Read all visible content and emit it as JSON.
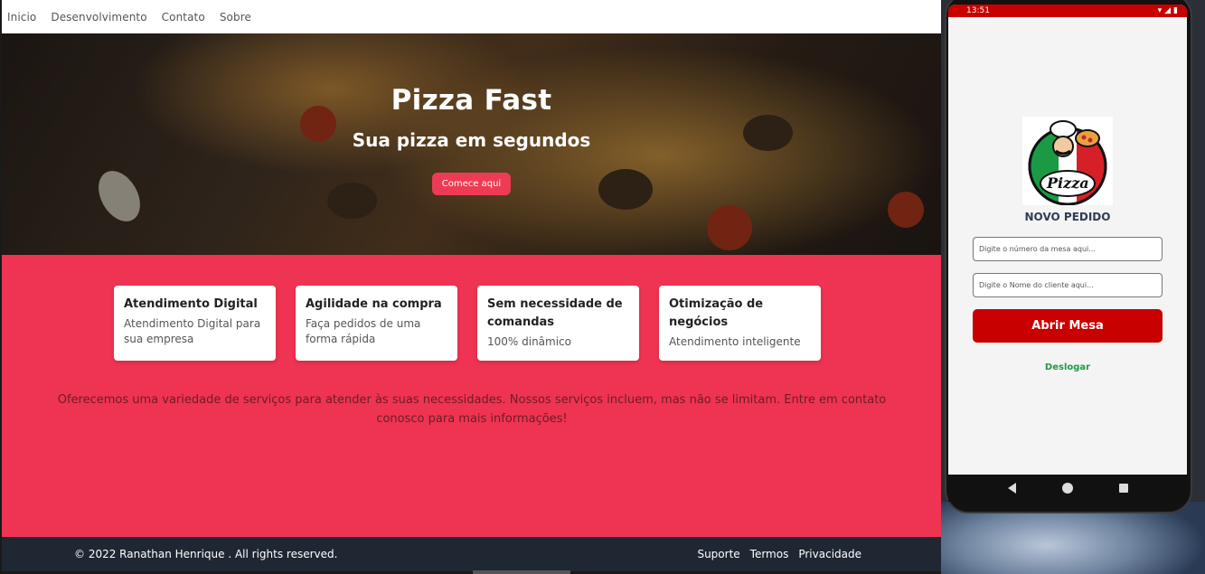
{
  "nav": {
    "items": [
      "Inicio",
      "Desenvolvimento",
      "Contato",
      "Sobre"
    ]
  },
  "hero": {
    "title": "Pizza Fast",
    "subtitle": "Sua pizza em segundos",
    "button": "Comece aqui"
  },
  "cards": [
    {
      "title": "Atendimento Digital",
      "text": "Atendimento Digital para sua empresa"
    },
    {
      "title": "Agilidade na compra",
      "text": "Faça pedidos de uma forma rápida"
    },
    {
      "title": "Sem necessidade de comandas",
      "text": "100% dinâmico"
    },
    {
      "title": "Otimização de negócios",
      "text": "Atendimento inteligente"
    }
  ],
  "about": "Oferecemos uma variedade de serviços para atender às suas necessidades. Nossos serviços incluem, mas não se limitam. Entre em contato conosco para mais informações!",
  "footer": {
    "copyright": "© 2022 Ranathan Henrique . All rights reserved.",
    "links": [
      "Suporte",
      "Termos",
      "Privacidade"
    ]
  },
  "phone": {
    "status_time": "13:51",
    "logo_text": "Pizza",
    "heading": "NOVO PEDIDO",
    "mesa_placeholder": "Digite o número da mesa aqui...",
    "cliente_placeholder": "Digite o Nome do cliente aqui...",
    "abrir_button": "Abrir Mesa",
    "deslogar": "Deslogar"
  },
  "colors": {
    "accent": "#ef3352",
    "footer": "#1f2733",
    "app_red": "#c80000",
    "app_green": "#1f9a43"
  }
}
